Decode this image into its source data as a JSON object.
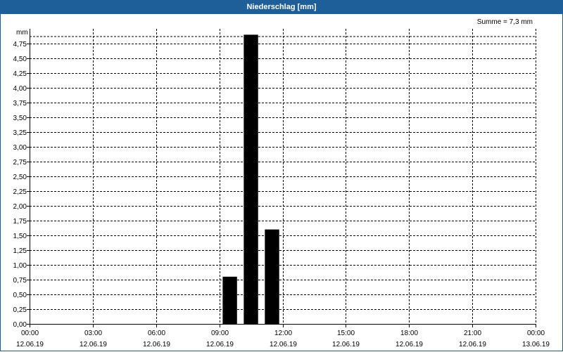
{
  "window": {
    "title": "Niederschlag [mm]"
  },
  "summary": {
    "text": "Summe = 7,3 mm"
  },
  "chart_data": {
    "type": "bar",
    "title": "Niederschlag [mm]",
    "ylabel": "mm",
    "xlabel": "",
    "ylim": [
      0,
      5.0
    ],
    "ytick_step": 0.25,
    "y_tick_labels": [
      "0,00",
      "0,25",
      "0,50",
      "0,75",
      "1,00",
      "1,25",
      "1,50",
      "1,75",
      "2,00",
      "2,25",
      "2,50",
      "2,75",
      "3,00",
      "3,25",
      "3,50",
      "3,75",
      "4,00",
      "4,25",
      "4,50",
      "4,75"
    ],
    "x_range_hours": [
      0,
      24
    ],
    "x_ticks": [
      {
        "hour": 0,
        "time": "00:00",
        "date": "12.06.19"
      },
      {
        "hour": 3,
        "time": "03:00",
        "date": "12.06.19"
      },
      {
        "hour": 6,
        "time": "06:00",
        "date": "12.06.19"
      },
      {
        "hour": 9,
        "time": "09:00",
        "date": "12.06.19"
      },
      {
        "hour": 12,
        "time": "12:00",
        "date": "12.06.19"
      },
      {
        "hour": 15,
        "time": "15:00",
        "date": "12.06.19"
      },
      {
        "hour": 18,
        "time": "18:00",
        "date": "12.06.19"
      },
      {
        "hour": 21,
        "time": "21:00",
        "date": "12.06.19"
      },
      {
        "hour": 24,
        "time": "00:00",
        "date": "13.06.19"
      }
    ],
    "bars": [
      {
        "hour": 9.5,
        "value": 0.8
      },
      {
        "hour": 10.5,
        "value": 4.9
      },
      {
        "hour": 11.5,
        "value": 1.6
      }
    ],
    "bar_color": "#000000",
    "grid": true,
    "grid_style": "dashed"
  }
}
